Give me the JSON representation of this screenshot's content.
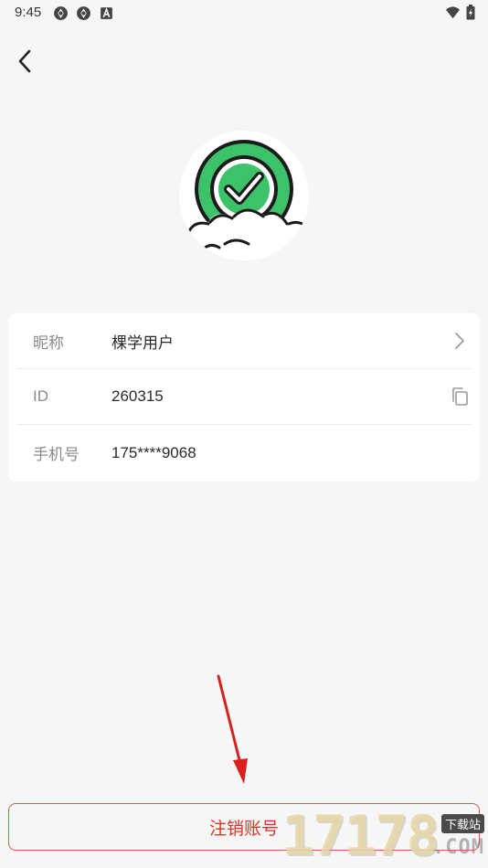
{
  "status_bar": {
    "time": "9:45",
    "icons": [
      "sync-icon",
      "sync-icon",
      "font-a-icon",
      "wifi-icon",
      "battery-icon"
    ]
  },
  "header": {
    "back_icon": "chevron-left-icon"
  },
  "profile": {
    "avatar_description_icon": "green-check-cloud-avatar-icon",
    "rows": [
      {
        "label": "昵称",
        "value": "棵学用户",
        "action_icon": "chevron-right-icon"
      },
      {
        "label": "ID",
        "value": "260315",
        "action_icon": "copy-icon"
      },
      {
        "label": "手机号",
        "value": "175****9068",
        "action_icon": ""
      }
    ]
  },
  "actions": {
    "deactivate_label": "注销账号"
  },
  "watermark": {
    "number": "17178",
    "site_label": "下载站",
    "domain_text": ".COM"
  },
  "colors": {
    "background": "#f6f6f6",
    "card": "#ffffff",
    "danger": "#d9332a",
    "avatar_green": "#3cc36a",
    "annotation_red": "#d9201c"
  }
}
